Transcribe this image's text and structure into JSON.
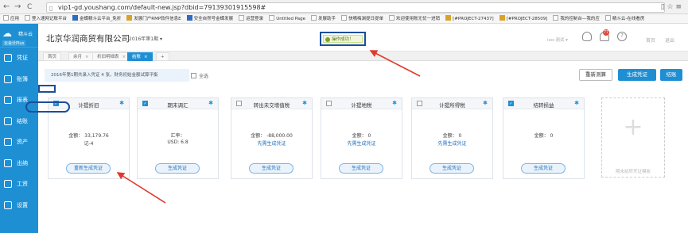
{
  "browser": {
    "back": "←",
    "forward": "→",
    "reload": "C",
    "url": "vip1-gd.youshang.com/default-new.jsp?dbid=79139301915598#",
    "ext_icons": "▯ ☆ ≡"
  },
  "bookmarks": [
    {
      "label": "应用",
      "style": "grid"
    },
    {
      "label": "登入速网记账平台",
      "style": ""
    },
    {
      "label": "金蝶精斗云平台_免折",
      "style": "blue"
    },
    {
      "label": "发展门户RMP软件信息E",
      "style": "gold"
    },
    {
      "label": "安全自然号金蝶发展",
      "style": "blue"
    },
    {
      "label": "运营登录",
      "style": ""
    },
    {
      "label": "Untitled Page",
      "style": ""
    },
    {
      "label": "发展助手",
      "style": ""
    },
    {
      "label": "快嘴梅渊提日提单",
      "style": ""
    },
    {
      "label": "欢迎使用账无忧一进销",
      "style": ""
    },
    {
      "label": "[#PROJECT-27437]",
      "style": "gold"
    },
    {
      "label": "[#PROJECT-28509]",
      "style": "gold"
    },
    {
      "label": "我的控制台—我的应",
      "style": ""
    },
    {
      "label": "精斗云-在线看房",
      "style": ""
    }
  ],
  "sidebar": {
    "brand": "精斗云",
    "subtitle": "云会计Plus",
    "items": [
      {
        "label": "凭证",
        "icon": "voucher-icon"
      },
      {
        "label": "账簿",
        "icon": "ledger-icon"
      },
      {
        "label": "报表",
        "icon": "report-icon"
      },
      {
        "label": "结账",
        "icon": "close-account-icon"
      },
      {
        "label": "资产",
        "icon": "asset-icon"
      },
      {
        "label": "出纳",
        "icon": "cashier-icon"
      },
      {
        "label": "工资",
        "icon": "payroll-icon"
      },
      {
        "label": "设置",
        "icon": "gear-icon"
      }
    ]
  },
  "header": {
    "company": "北京华润商贸有限公司",
    "period": "2016年第1期 ▾",
    "toast": "操作成功！",
    "user": "ioo-测试 ▾",
    "notifications": "77",
    "home": "首页",
    "logout": "退出"
  },
  "tabs": [
    {
      "label": "首页",
      "closable": false,
      "active": false
    },
    {
      "label": "余月",
      "closable": true,
      "active": false
    },
    {
      "label": "折旧明细表",
      "closable": true,
      "active": false
    },
    {
      "label": "结账",
      "closable": true,
      "active": true
    },
    {
      "label": "+",
      "closable": false,
      "active": false
    }
  ],
  "main": {
    "info": "2016年第1期共录入凭证 4 张，财务初始金额试算平衡",
    "select_all": "全选",
    "btn_recalc": "重新测算",
    "btn_generate": "生成凭证",
    "btn_close": "结账"
  },
  "cards": [
    {
      "title": "计提折旧",
      "checked": true,
      "line1": "金额：  33,179.76",
      "line2": "记-4",
      "line2_link": false,
      "button": "重新生成凭证"
    },
    {
      "title": "期末调汇",
      "checked": true,
      "line1": "汇率：",
      "line2": "USD: 6.8",
      "line2_link": false,
      "button": "生成凭证"
    },
    {
      "title": "转出未交增值税",
      "checked": false,
      "line1": "金额：  -88,000.00",
      "line2": "先需生成凭证",
      "line2_link": true,
      "button": "生成凭证"
    },
    {
      "title": "计提地税",
      "checked": false,
      "line1": "金额：  0",
      "line2": "先需生成凭证",
      "line2_link": true,
      "button": "生成凭证"
    },
    {
      "title": "计提所得税",
      "checked": false,
      "line1": "金额：  0",
      "line2": "先需生成凭证",
      "line2_link": true,
      "button": "生成凭证"
    },
    {
      "title": "结转损益",
      "checked": true,
      "line1": "金额：  0",
      "line2": "",
      "line2_link": false,
      "button": "生成凭证"
    }
  ],
  "add_card": "期末结转凭证模板",
  "colors": {
    "primary": "#1f8fd4",
    "annotation_box": "#1a4f9c",
    "arrow": "#e03a2c"
  }
}
